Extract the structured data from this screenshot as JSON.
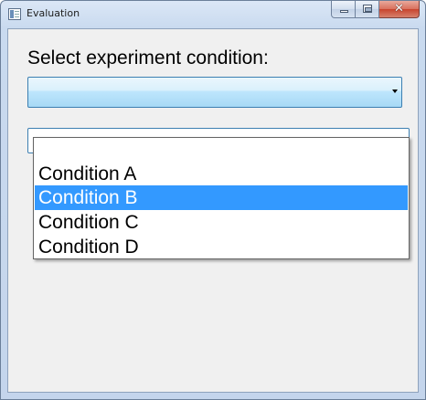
{
  "window": {
    "title": "Evaluation",
    "close_glyph": "✕"
  },
  "main": {
    "prompt_label": "Select experiment condition:",
    "combo_value": ""
  },
  "dropdown": {
    "options": [
      {
        "label": ""
      },
      {
        "label": "Condition A"
      },
      {
        "label": "Condition B",
        "selected": true
      },
      {
        "label": "Condition C"
      },
      {
        "label": "Condition D"
      }
    ]
  },
  "colors": {
    "selection": "#3399ff",
    "client_bg": "#f0f0f0",
    "frame": "#c4d5ec"
  },
  "icons": [
    "app-icon",
    "minimize-icon",
    "maximize-icon",
    "close-icon",
    "chevron-down-icon"
  ]
}
